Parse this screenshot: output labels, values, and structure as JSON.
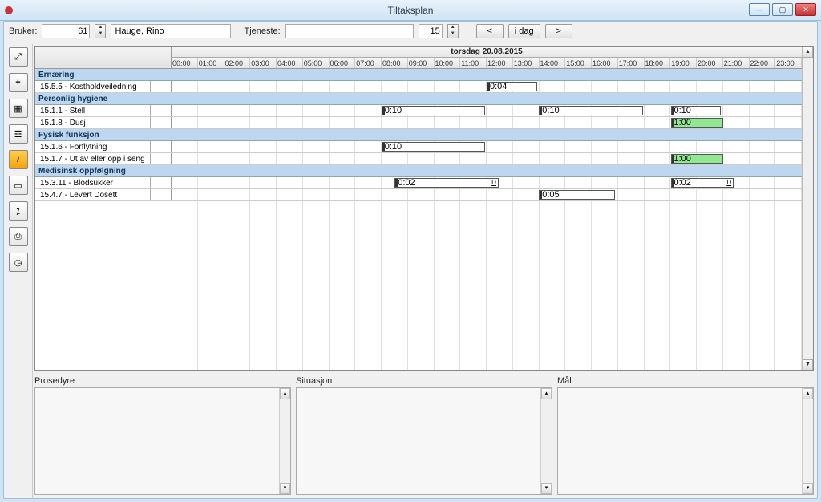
{
  "window": {
    "title": "Tiltaksplan"
  },
  "toolbar": {
    "bruker_label": "Bruker:",
    "bruker_id": "61",
    "bruker_name": "Hauge, Rino",
    "tjeneste_label": "Tjeneste:",
    "tjeneste_value": "",
    "tjeneste_id": "15",
    "prev": "<",
    "today": "i dag",
    "next": ">"
  },
  "schedule": {
    "date_header": "torsdag 20.08.2015",
    "hours": [
      "00:00",
      "01:00",
      "02:00",
      "03:00",
      "04:00",
      "05:00",
      "06:00",
      "07:00",
      "08:00",
      "09:00",
      "10:00",
      "11:00",
      "12:00",
      "13:00",
      "14:00",
      "15:00",
      "16:00",
      "17:00",
      "18:00",
      "19:00",
      "20:00",
      "21:00",
      "22:00",
      "23:00"
    ],
    "groups": [
      {
        "name": "Ernæring",
        "rows": [
          {
            "label": "15.5.5 - Kostholdveiledning",
            "items": [
              {
                "start_pct": 50.0,
                "width_pct": 8.0,
                "text": "0:04",
                "mark": true
              }
            ]
          }
        ]
      },
      {
        "name": "Personlig hygiene",
        "rows": [
          {
            "label": "15.1.1 - Stell",
            "items": [
              {
                "start_pct": 33.3,
                "width_pct": 16.5,
                "text": "0:10",
                "mark": true
              },
              {
                "start_pct": 58.3,
                "width_pct": 16.5,
                "text": "0:10",
                "mark": true
              },
              {
                "start_pct": 79.2,
                "width_pct": 8.0,
                "text": "0:10",
                "mark": true
              }
            ]
          },
          {
            "label": "15.1.8 - Dusj",
            "items": [
              {
                "start_pct": 79.2,
                "width_pct": 8.3,
                "text": "1:00",
                "mark": true,
                "green": true
              }
            ]
          }
        ]
      },
      {
        "name": "Fysisk funksjon",
        "rows": [
          {
            "label": "15.1.6 - Forflytning",
            "items": [
              {
                "start_pct": 33.3,
                "width_pct": 16.5,
                "text": "0:10",
                "mark": true
              }
            ]
          },
          {
            "label": "15.1.7 - Ut av eller opp i seng",
            "items": [
              {
                "start_pct": 79.2,
                "width_pct": 8.3,
                "text": "1:00",
                "mark": true,
                "green": true
              }
            ]
          }
        ]
      },
      {
        "name": "Medisinsk oppfølgning",
        "rows": [
          {
            "label": "15.3.11 - Blodsukker",
            "items": [
              {
                "start_pct": 35.4,
                "width_pct": 16.5,
                "text": "0:02",
                "mark": true,
                "d": true
              },
              {
                "start_pct": 79.2,
                "width_pct": 10.0,
                "text": "0:02",
                "mark": true,
                "d": true
              }
            ]
          },
          {
            "label": "15.4.7 - Levert Dosett",
            "items": [
              {
                "start_pct": 58.3,
                "width_pct": 12.0,
                "text": "0:05",
                "mark": true
              }
            ]
          }
        ]
      }
    ]
  },
  "panes": {
    "prosedyre": "Prosedyre",
    "situasjon": "Situasjon",
    "mal": "Mål"
  },
  "icons": {
    "expand": "⤢",
    "add": "+",
    "calendar": "▦",
    "clipboard": "☲",
    "info": "i",
    "card": "▭",
    "chart": "⁒",
    "print": "⎙",
    "clock": "◷"
  }
}
